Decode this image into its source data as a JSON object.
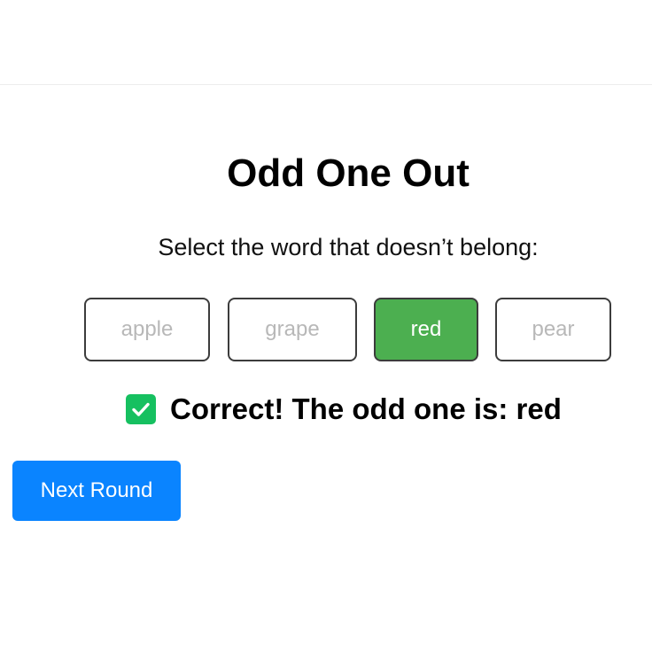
{
  "game": {
    "title": "Odd One Out",
    "instruction": "Select the word that doesn’t belong:",
    "words": [
      {
        "label": "apple",
        "state": "dimmed"
      },
      {
        "label": "grape",
        "state": "dimmed"
      },
      {
        "label": "red",
        "state": "selected-correct"
      },
      {
        "label": "pear",
        "state": "dimmed"
      }
    ],
    "feedback": {
      "icon": "check-mark-icon",
      "text": "Correct! The odd one is: red"
    },
    "next_button_label": "Next Round"
  },
  "colors": {
    "correct": "#4caf50",
    "check_badge": "#16c060",
    "primary": "#0a84ff",
    "dimmed_text": "#b8b8b8"
  }
}
